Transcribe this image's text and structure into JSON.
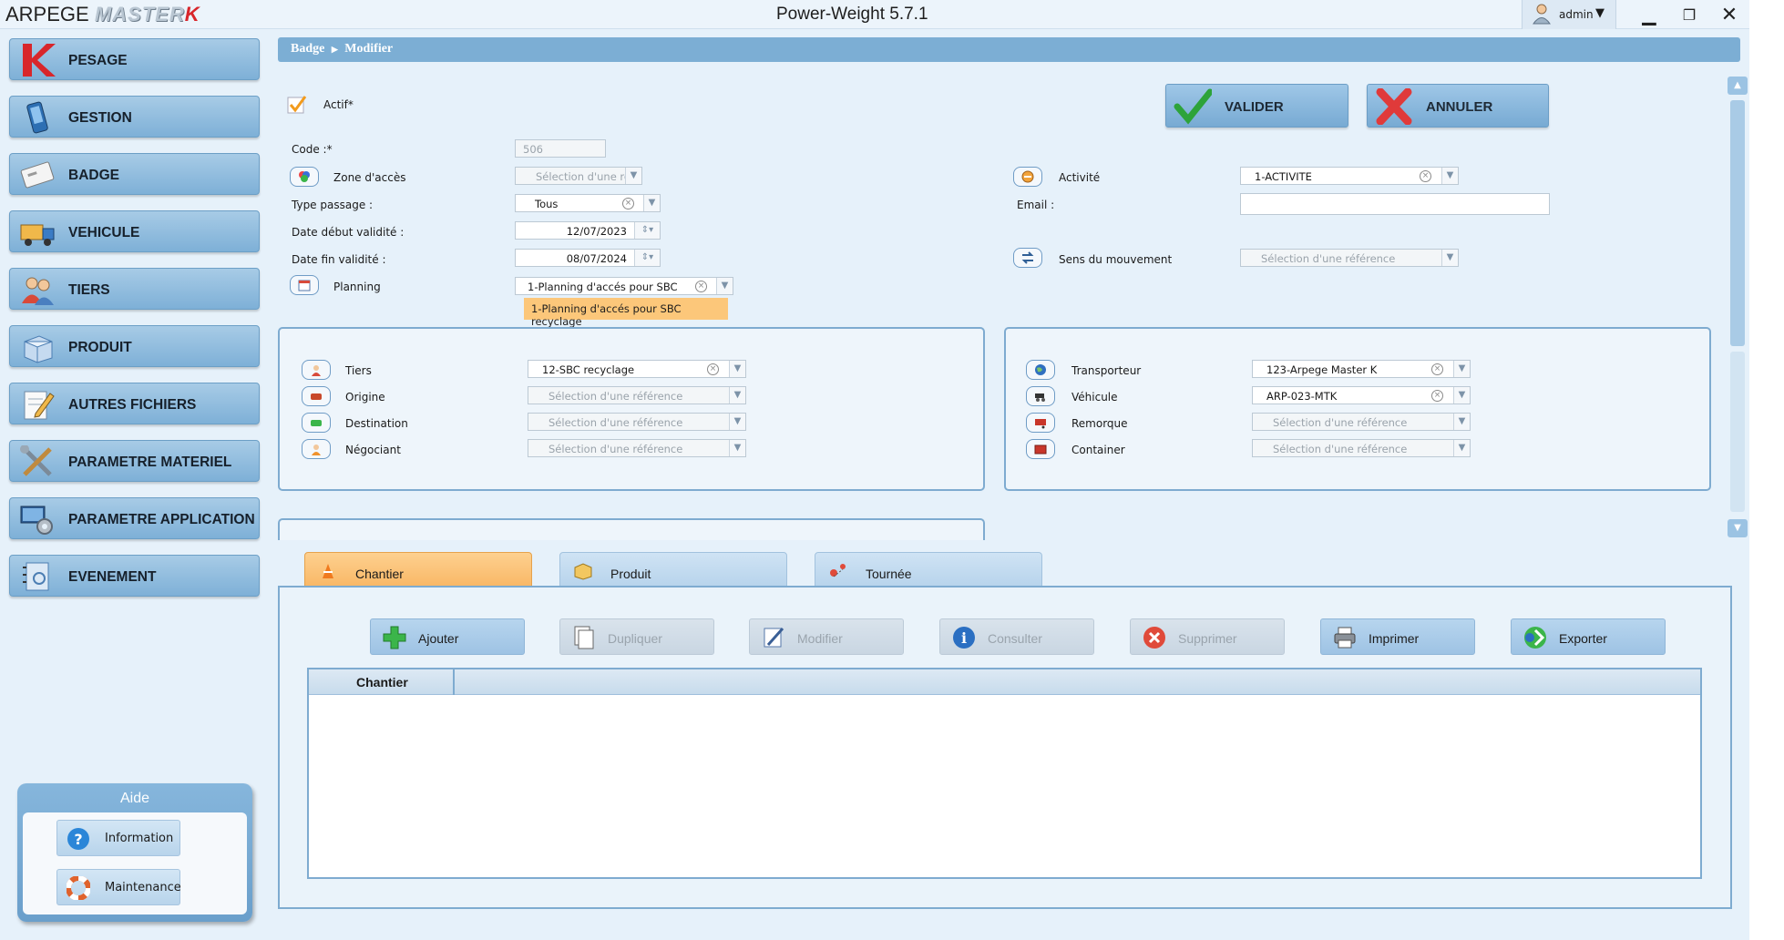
{
  "app": {
    "brand_text": "ARPEGE",
    "brand_logo": "MASTER",
    "brand_logo_k": "K",
    "title": "Power-Weight 5.7.1",
    "user": "admin"
  },
  "nav": [
    {
      "label": "PESAGE",
      "icon": "scale-k-icon"
    },
    {
      "label": "GESTION",
      "icon": "phone-icon"
    },
    {
      "label": "BADGE",
      "icon": "badge-card-icon"
    },
    {
      "label": "VEHICULE",
      "icon": "truck-icon"
    },
    {
      "label": "TIERS",
      "icon": "people-icon"
    },
    {
      "label": "PRODUIT",
      "icon": "box-icon"
    },
    {
      "label": "AUTRES FICHIERS",
      "icon": "document-pen-icon"
    },
    {
      "label": "PARAMETRE MATERIEL",
      "icon": "tools-icon"
    },
    {
      "label": "PARAMETRE APPLICATION",
      "icon": "computer-gear-icon"
    },
    {
      "label": "EVENEMENT",
      "icon": "notebook-icon"
    }
  ],
  "help": {
    "title": "Aide",
    "information": "Information",
    "maintenance": "Maintenance"
  },
  "breadcrumb": {
    "section": "Badge",
    "page": "Modifier"
  },
  "actions": {
    "validate": "VALIDER",
    "cancel": "ANNULER"
  },
  "form": {
    "actif_label": "Actif*",
    "actif_checked": true,
    "code_label": "Code :*",
    "code_value": "506",
    "zone_label": "Zone d'accès",
    "zone_placeholder": "Sélection d'une ré",
    "type_label": "Type passage :",
    "type_value": "Tous",
    "date_debut_label": "Date début validité :",
    "date_debut_value": "12/07/2023",
    "date_fin_label": "Date fin validité :",
    "date_fin_value": "08/07/2024",
    "planning_label": "Planning",
    "planning_value": "1-Planning d'accés pour SBC",
    "planning_tooltip": "1-Planning d'accés pour SBC recyclage",
    "activite_label": "Activité",
    "activite_value": "1-ACTIVITE",
    "email_label": "Email :",
    "email_value": "",
    "sens_label": "Sens du mouvement",
    "sens_placeholder": "Sélection d'une référence"
  },
  "left_panel": [
    {
      "label": "Tiers",
      "value": "12-SBC recyclage",
      "placeholder": ""
    },
    {
      "label": "Origine",
      "value": "",
      "placeholder": "Sélection d'une référence"
    },
    {
      "label": "Destination",
      "value": "",
      "placeholder": "Sélection d'une référence"
    },
    {
      "label": "Négociant",
      "value": "",
      "placeholder": "Sélection d'une référence"
    }
  ],
  "right_panel": [
    {
      "label": "Transporteur",
      "value": "123-Arpege Master K",
      "placeholder": ""
    },
    {
      "label": "Véhicule",
      "value": "ARP-023-MTK",
      "placeholder": ""
    },
    {
      "label": "Remorque",
      "value": "",
      "placeholder": "Sélection d'une référence"
    },
    {
      "label": "Container",
      "value": "",
      "placeholder": "Sélection d'une référence"
    }
  ],
  "tabs": [
    {
      "label": "Chantier",
      "active": true
    },
    {
      "label": "Produit",
      "active": false
    },
    {
      "label": "Tournée",
      "active": false
    }
  ],
  "toolbar": [
    {
      "label": "Ajouter",
      "enabled": true
    },
    {
      "label": "Dupliquer",
      "enabled": false
    },
    {
      "label": "Modifier",
      "enabled": false
    },
    {
      "label": "Consulter",
      "enabled": false
    },
    {
      "label": "Supprimer",
      "enabled": false
    },
    {
      "label": "Imprimer",
      "enabled": true
    },
    {
      "label": "Exporter",
      "enabled": true
    }
  ],
  "grid": {
    "columns": [
      "Chantier"
    ],
    "rows": []
  },
  "colors": {
    "nav_blue": "#7eb0d7",
    "tab_active": "#fbbf73",
    "accent_red": "#d8262b"
  }
}
